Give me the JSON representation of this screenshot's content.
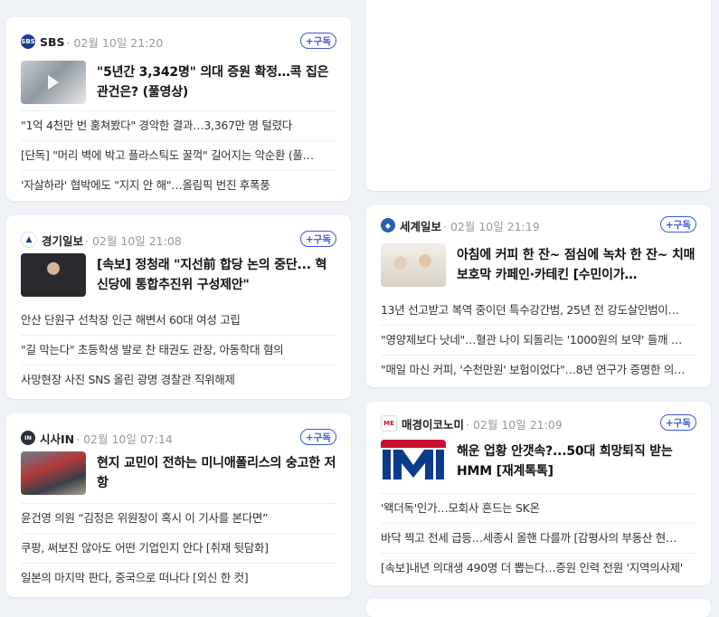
{
  "cards": [
    {
      "press": "SBS",
      "date": "· 02월 10일 21:20",
      "subscribe": "+구독",
      "headline": "\"5년간 3,342명\" 의대 증원 확정…콕 집은 관건은? (풀영상)",
      "items": [
        "\"1억 4천만 번 훔쳐봤다\" 경악한 결과…3,367만 명 털렸다",
        "[단독] \"머리 벽에 박고 플라스틱도 꿀꺽\" 길어지는 악순환 (풀…",
        "'자살하라' 협박에도 \"지지 안 해\"…올림픽 번진 후폭풍"
      ]
    },
    {
      "press": "경기일보",
      "date": "· 02월 10일 21:08",
      "subscribe": "+구독",
      "headline": "[속보] 정청래 \"지선前 합당 논의 중단... 혁신당에 통합추진위 구성제안\"",
      "items": [
        "안산 단원구 선착장 인근 해변서 60대 여성 고립",
        "\"길 막는다\" 초등학생 발로 찬 태권도 관장, 아동학대 혐의",
        "사망현장 사진 SNS 올린 광명 경찰관 직위해제"
      ]
    },
    {
      "press": "시사IN",
      "date": "· 02월 10일 07:14",
      "subscribe": "+구독",
      "headline": "현지 교민이 전하는 미니애폴리스의 숭고한 저항",
      "items": [
        "윤건영 의원 “김정은 위원장이 혹시 이 기사를 본다면”",
        "쿠팡, 써보진 않아도 어떤 기업인지 안다 [취재 뒷담화]",
        "일본의 마지막 판다, 중국으로 떠나다 [외신 한 컷]"
      ]
    },
    {
      "press": "세계일보",
      "date": "· 02월 10일 21:19",
      "subscribe": "+구독",
      "headline": "아침에 커피 한 잔~ 점심에 녹차 한 잔~ 치매 보호막 카페인·카테킨 [수민이가…",
      "items": [
        "13년 선고받고 복역 중이던 특수강간범, 25년 전 강도살인범이…",
        "\"영양제보다 낫네\"…혈관 나이 되돌리는 '1000원의 보약' 들깨 …",
        "\"매일 마신 커피, '수천만원' 보험이었다\"…8년 연구가 증명한 의…"
      ]
    },
    {
      "press": "매경이코노미",
      "date": "· 02월 10일 21:09",
      "subscribe": "+구독",
      "headline": "해운 업황 안갯속?...50대 희망퇴직 받는 HMM [재계톡톡]",
      "items": [
        "'왝더독'인가…모회사 흔드는 SK온",
        "바닥 찍고 전세 급등…세종시 올핸 다를까 [감평사의 부동산 현…",
        "[속보]내년 의대생 490명 더 뽑는다…증원 인력 전원 '지역의사제'"
      ]
    }
  ],
  "colors": {
    "accent": "#3a5bd9",
    "background": "#eef1f5"
  }
}
